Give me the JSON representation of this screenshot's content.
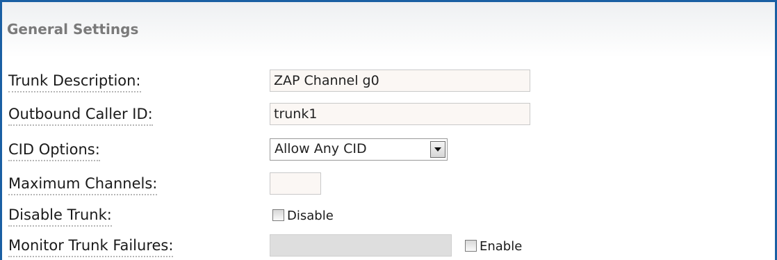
{
  "section": {
    "title": "General Settings"
  },
  "fields": {
    "trunk_description": {
      "label": "Trunk Description:",
      "value": "ZAP Channel g0"
    },
    "outbound_caller_id": {
      "label": "Outbound Caller ID:",
      "value": "trunk1"
    },
    "cid_options": {
      "label": "CID Options:",
      "selected": "Allow Any CID"
    },
    "maximum_channels": {
      "label": "Maximum Channels:",
      "value": ""
    },
    "disable_trunk": {
      "label": "Disable Trunk:",
      "checkbox_label": "Disable",
      "checked": false
    },
    "monitor_trunk_failures": {
      "label": "Monitor Trunk Failures:",
      "value": "",
      "checkbox_label": "Enable",
      "checked": false
    }
  },
  "colors": {
    "frame_border": "#1a5fa3",
    "section_title": "#7a7a7a",
    "input_background": "#fbf7f4",
    "disabled_input_background": "#dedede"
  },
  "icons": {
    "dropdown": "chevron-down-icon"
  }
}
